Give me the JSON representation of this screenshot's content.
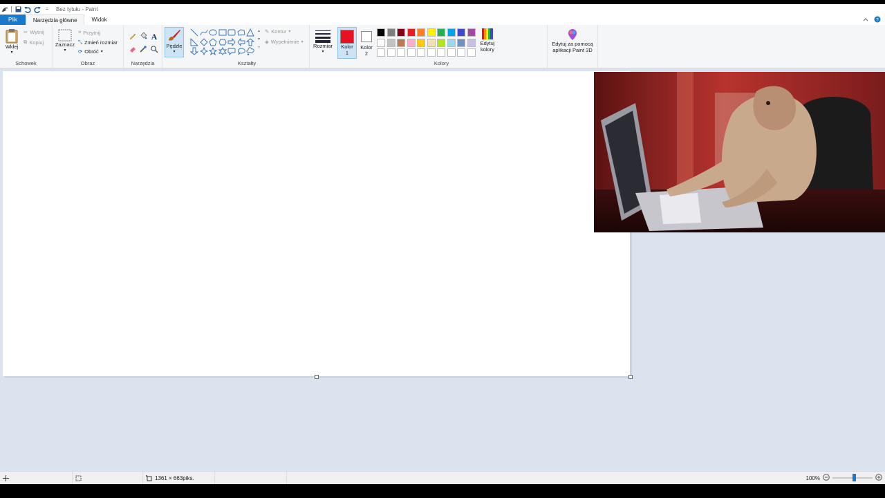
{
  "window": {
    "title": "Bez tytułu - Paint",
    "quick_access": [
      "paint-app-icon",
      "save-icon",
      "undo-icon",
      "redo-icon",
      "customize-quick-access-icon"
    ]
  },
  "tabs": {
    "file": "Plik",
    "home": "Narzędzia główne",
    "view": "Widok",
    "right_icons": [
      "minimize-ribbon-icon",
      "help-icon"
    ]
  },
  "ribbon": {
    "clipboard": {
      "group_label": "Schowek",
      "paste": "Wklej",
      "cut": "Wytnij",
      "copy": "Kopiuj"
    },
    "image": {
      "group_label": "Obraz",
      "select": "Zaznacz",
      "crop": "Przytnij",
      "resize": "Zmień rozmiar",
      "rotate": "Obróć"
    },
    "tools": {
      "group_label": "Narzędzia",
      "icons": [
        "pencil-icon",
        "fill-icon",
        "text-icon",
        "eraser-icon",
        "color-picker-icon",
        "magnifier-icon"
      ]
    },
    "brushes": {
      "label": "Pędzle"
    },
    "shapes": {
      "group_label": "Kształty",
      "outline": "Kontur",
      "fill": "Wypełnienie",
      "icons": [
        "line",
        "curve",
        "oval",
        "rectangle",
        "rounded-rectangle",
        "polygon",
        "triangle",
        "right-triangle",
        "diamond",
        "pentagon",
        "hexagon",
        "right-arrow",
        "left-arrow",
        "up-arrow",
        "down-arrow",
        "four-point-star",
        "five-point-star",
        "six-point-star",
        "rounded-callout",
        "oval-callout",
        "cloud-callout"
      ]
    },
    "size": {
      "label": "Rozmiar"
    },
    "colors": {
      "group_label": "Kolory",
      "color1_label": "Kolor 1",
      "color2_label": "Kolor 2",
      "color1": "#e81123",
      "color2": "#ffffff",
      "edit_colors": "Edytuj kolory",
      "palette": [
        "#000000",
        "#7f7f7f",
        "#880015",
        "#ed1c24",
        "#ff7f27",
        "#fff200",
        "#22b14c",
        "#00a2e8",
        "#3f48cc",
        "#a349a4",
        "#ffffff",
        "#c3c3c3",
        "#b97a57",
        "#ffaec9",
        "#ffc90e",
        "#efe4b0",
        "#b5e61d",
        "#99d9ea",
        "#7092be",
        "#c8bfe7",
        "#ffffff",
        "#ffffff",
        "#ffffff",
        "#ffffff",
        "#ffffff",
        "#ffffff",
        "#ffffff",
        "#ffffff",
        "#ffffff",
        "#ffffff"
      ]
    },
    "paint3d": {
      "label": "Edytuj za pomocą aplikacji Paint 3D"
    }
  },
  "status": {
    "cursor_icon": "cursor-position-icon",
    "selection_icon": "selection-size-icon",
    "canvas_size": "1361 × 663piks.",
    "zoom": "100%"
  }
}
